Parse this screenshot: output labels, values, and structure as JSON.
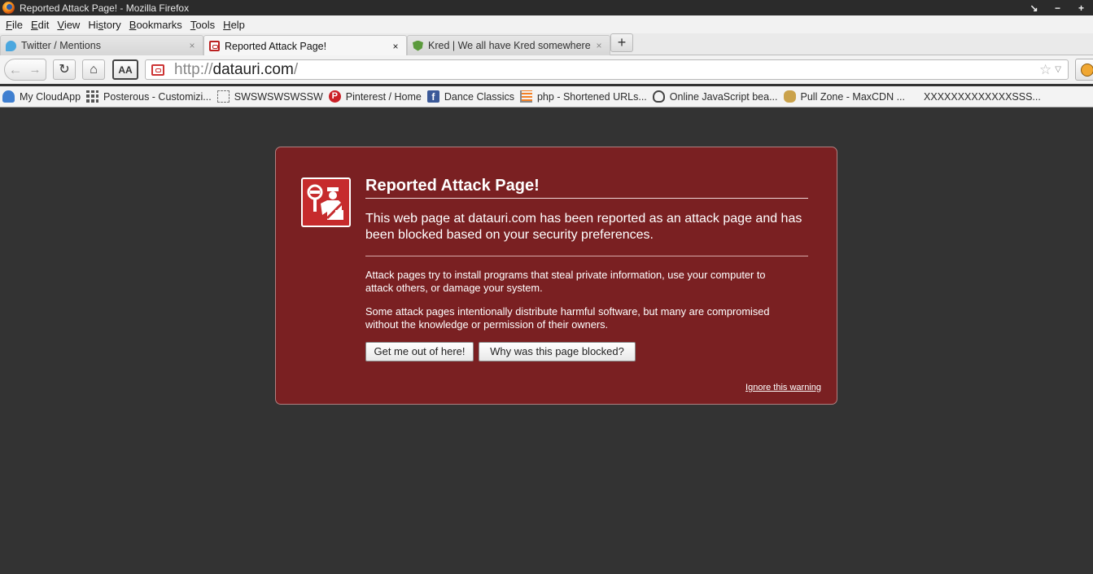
{
  "window": {
    "title": "Reported Attack Page! - Mozilla Firefox",
    "controls": [
      "↘",
      "−",
      "+"
    ]
  },
  "menu": {
    "items": [
      {
        "label": "File",
        "access": "F",
        "rest": "ile"
      },
      {
        "label": "Edit",
        "access": "E",
        "rest": "dit"
      },
      {
        "label": "View",
        "access": "V",
        "rest": "iew"
      },
      {
        "label": "History",
        "access": "",
        "rest": "History",
        "pre": "Hi",
        "u": "s",
        "post": "tory"
      },
      {
        "label": "Bookmarks",
        "access": "B",
        "rest": "ookmarks"
      },
      {
        "label": "Tools",
        "access": "T",
        "rest": "ools"
      },
      {
        "label": "Help",
        "access": "H",
        "rest": "elp"
      }
    ]
  },
  "tabs": [
    {
      "label": "Twitter / Mentions",
      "icon": "twitter-icon",
      "close": "×"
    },
    {
      "label": "Reported Attack Page!",
      "icon": "attack-page-icon",
      "close": "×",
      "active": true
    },
    {
      "label": "Kred | We all have Kred somewhere",
      "icon": "kred-icon",
      "close": "×"
    }
  ],
  "new_tab": "+",
  "nav": {
    "back": "←",
    "forward": "→",
    "reload": "↻",
    "home": "⌂",
    "reader": "AA",
    "url_scheme": "http://",
    "url_host": "datauri.com",
    "url_path": "/",
    "star": "☆",
    "dropdown": "▽"
  },
  "bookmarks": [
    {
      "label": "My CloudApp",
      "icon": "cloud-icon"
    },
    {
      "label": "Posterous - Customizi...",
      "icon": "grid-icon"
    },
    {
      "label": "SWSWSWSWSSW",
      "icon": "blank-page-icon"
    },
    {
      "label": "Pinterest / Home",
      "icon": "pinterest-icon"
    },
    {
      "label": "Dance Classics",
      "icon": "facebook-icon"
    },
    {
      "label": "php - Shortened URLs...",
      "icon": "stackoverflow-icon"
    },
    {
      "label": "Online JavaScript bea...",
      "icon": "owl-icon"
    },
    {
      "label": "Pull Zone - MaxCDN ...",
      "icon": "maxcdn-icon"
    },
    {
      "label": "XXXXXXXXXXXXXSSS...",
      "icon": ""
    }
  ],
  "error": {
    "title": "Reported Attack Page!",
    "short_desc": "This web page at datauri.com has been reported as an attack page and has been blocked based on your security preferences.",
    "long_desc_1": "Attack pages try to install programs that steal private information, use your computer to attack others, or damage your system.",
    "long_desc_2": "Some attack pages intentionally distribute harmful software, but many are compromised without the knowledge or permission of their owners.",
    "btn_get_out": "Get me out of here!",
    "btn_why": "Why was this page blocked?",
    "ignore": "Ignore this warning"
  },
  "colors": {
    "error_bg": "#7a2022",
    "content_bg": "#333333",
    "shield_red": "#c62b2d"
  }
}
